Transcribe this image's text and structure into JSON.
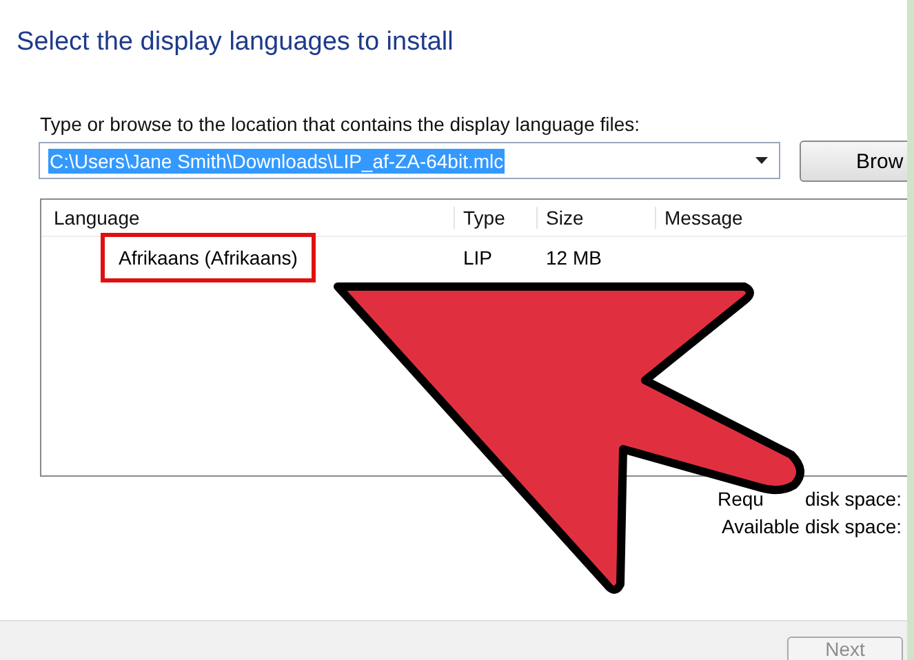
{
  "title": "Select the display languages to install",
  "location": {
    "label": "Type or browse to the location that contains the display language files:",
    "value": "C:\\Users\\Jane Smith\\Downloads\\LIP_af-ZA-64bit.mlc",
    "value_selected": true,
    "browse_button": "Brow"
  },
  "table": {
    "columns": [
      "Language",
      "Type",
      "Size",
      "Message"
    ],
    "rows": [
      {
        "language": "Afrikaans (Afrikaans)",
        "type": "LIP",
        "size": "12 MB",
        "highlighted": true
      }
    ]
  },
  "disk_space": [
    [
      "Requ",
      "disk space:"
    ],
    [
      "Available disk space:"
    ]
  ],
  "buttons": [
    {
      "label": "Next",
      "disabled": true
    }
  ]
}
